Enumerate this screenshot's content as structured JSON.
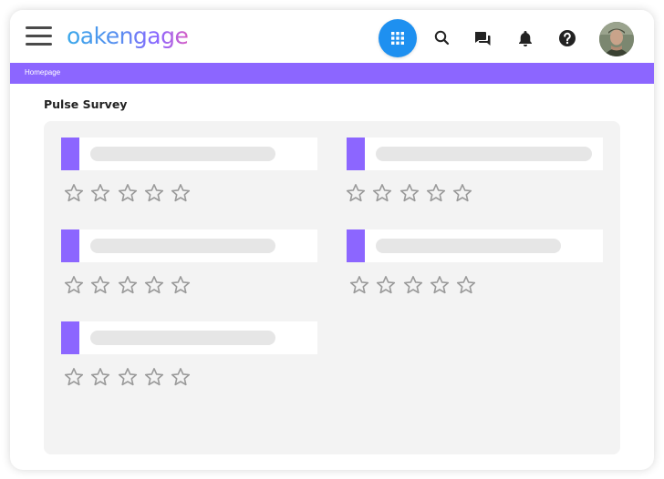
{
  "app": {
    "logo_text": "oakengage"
  },
  "header": {
    "apps_icon": "grid-apps-icon",
    "search_icon": "search-icon",
    "chat_icon": "chat-icon",
    "notifications_icon": "bell-icon",
    "help_icon": "help-icon"
  },
  "breadcrumb": {
    "label": "Homepage"
  },
  "page": {
    "title": "Pulse Survey"
  },
  "colors": {
    "accent_purple": "#8c66ff",
    "apps_blue": "#1e90f0",
    "panel_bg": "#f3f3f3",
    "placeholder": "#e6e6e6",
    "star_outline": "#9a9a9a"
  },
  "survey": {
    "questions": [
      {
        "rating": 0,
        "max_rating": 5
      },
      {
        "rating": 0,
        "max_rating": 5
      },
      {
        "rating": 0,
        "max_rating": 5
      },
      {
        "rating": 0,
        "max_rating": 5
      },
      {
        "rating": 0,
        "max_rating": 5
      }
    ]
  }
}
